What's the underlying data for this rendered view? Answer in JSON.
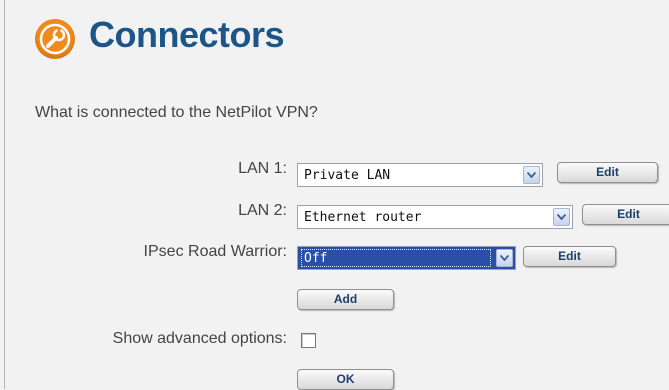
{
  "header": {
    "title": "Connectors",
    "logo_icon": "wrench-icon",
    "accent": "#1c5587",
    "logo_color": "#f08a1c"
  },
  "question": "What is connected to the NetPilot VPN?",
  "connectors": [
    {
      "label": "LAN 1:",
      "value": "Private LAN",
      "edit_label": "Edit"
    },
    {
      "label": "LAN 2:",
      "value": "Ethernet router",
      "edit_label": "Edit"
    },
    {
      "label": "IPsec Road Warrior:",
      "value": "Off",
      "edit_label": "Edit"
    }
  ],
  "add_label": "Add",
  "advanced": {
    "label": "Show advanced options:",
    "checked": false
  },
  "ok_label": "OK"
}
